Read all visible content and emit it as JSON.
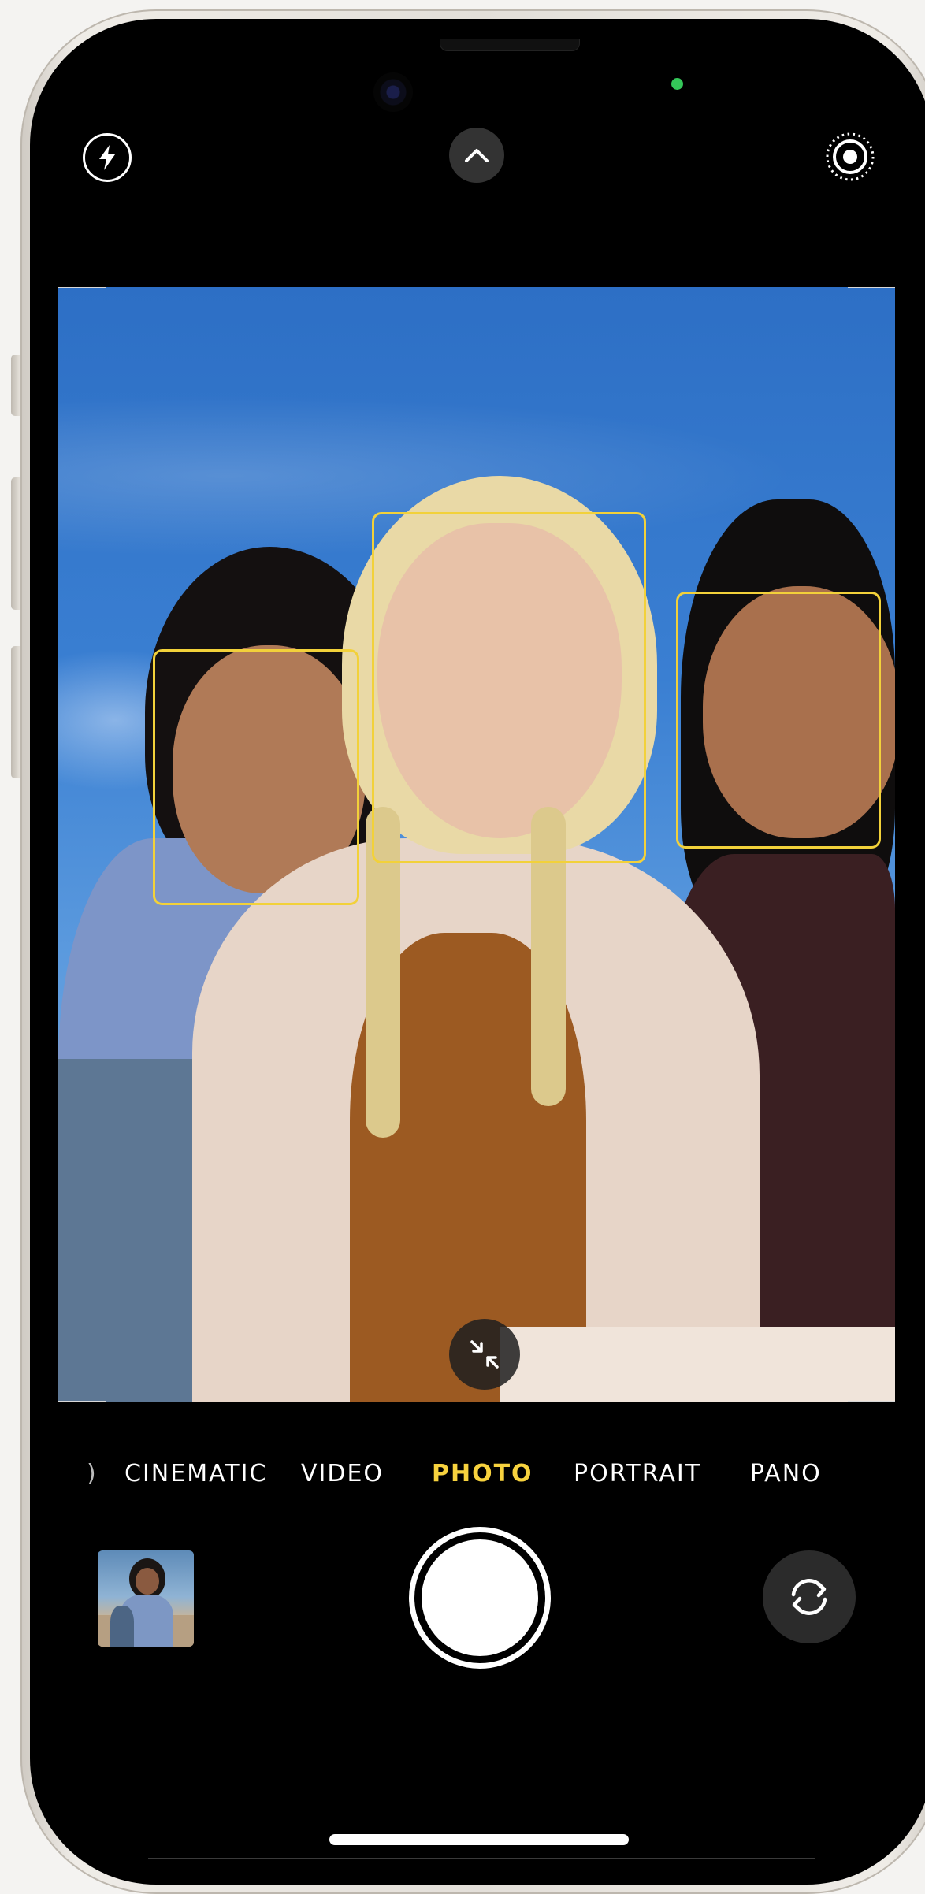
{
  "camera": {
    "modes": [
      {
        "label": "CINEMATIC",
        "active": false
      },
      {
        "label": "VIDEO",
        "active": false
      },
      {
        "label": "PHOTO",
        "active": true
      },
      {
        "label": "PORTRAIT",
        "active": false
      },
      {
        "label": "PANO",
        "active": false
      }
    ],
    "accent_color": "#f7d23e",
    "face_box_color": "#f2d13a",
    "status_indicator_color": "#34c759",
    "icons": {
      "flash": "flash-icon",
      "controls_toggle": "chevron-up-icon",
      "live_photo": "live-photo-icon",
      "zoom": "zoom-minimize-icon",
      "flip": "camera-flip-icon"
    }
  }
}
